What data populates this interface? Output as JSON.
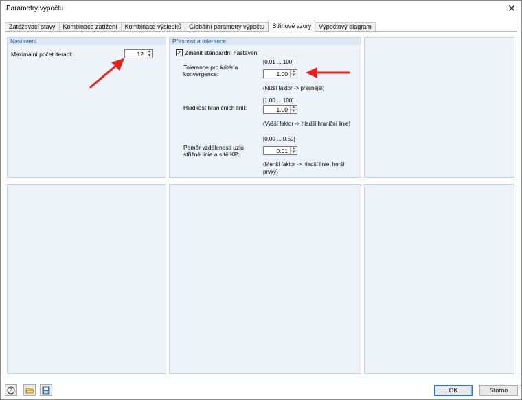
{
  "window": {
    "title": "Parametry výpočtu",
    "close_symbol": "✕"
  },
  "tabs": [
    {
      "label": "Zatěžovací stavy",
      "active": false
    },
    {
      "label": "Kombinace zatížení",
      "active": false
    },
    {
      "label": "Kombinace výsledků",
      "active": false
    },
    {
      "label": "Globální parametry výpočtu",
      "active": false
    },
    {
      "label": "Střihové vzory",
      "active": true
    },
    {
      "label": "Výpočtový diagram",
      "active": false
    }
  ],
  "nastaveni": {
    "header": "Nastavení",
    "max_iter_label": "Maximální počet iterací:",
    "max_iter_value": "12"
  },
  "presnost": {
    "header": "Přesnost a tolerance",
    "change_default_label": "Změnit standardní nastavení",
    "change_default_checked": true,
    "tolerance": {
      "label_line1": "Tolerance pro kritéria",
      "label_line2": "konvergence:",
      "range": "[0.01 ... 100]",
      "value": "1.00",
      "hint": "(Nižší faktor -> přesnější)"
    },
    "hladkost": {
      "label": "Hladkost hraničních linií:",
      "range": "[1.00 ... 100]",
      "value": "1.00",
      "hint": "(Vyšší faktor -> hladší hraniční linie)"
    },
    "pomer": {
      "label_line1": "Poměr vzdálenosti uzlu",
      "label_line2": "střižné linie a sítě KP:",
      "range": "[0.00 ... 0.50]",
      "value": "0.01",
      "hint_line1": "(Menší faktor -> hladší linie, horší",
      "hint_line2": "prvky)"
    }
  },
  "buttons": {
    "ok": "OK",
    "cancel": "Storno"
  },
  "icons": {
    "help": "help-icon",
    "open": "open-folder-icon",
    "save": "save-icon",
    "annotation": "red-arrow-annotation"
  },
  "colors": {
    "arrow": "#e8201a",
    "panel_bg": "#eef3f9",
    "panel_header": "#dde7f2",
    "header_text": "#1f4e8c",
    "accent": "#2a79d8"
  }
}
